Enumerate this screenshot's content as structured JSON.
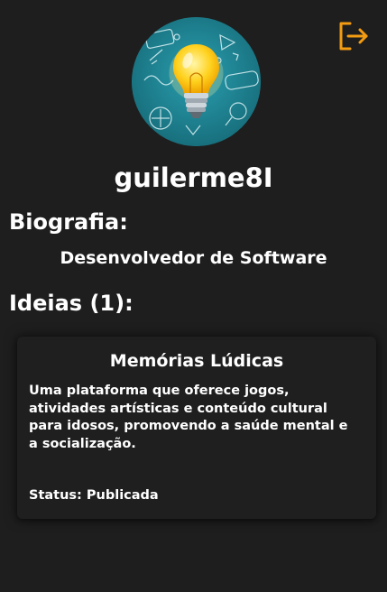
{
  "header": {
    "logout_icon": "logout-icon",
    "logout_color": "#f39c12"
  },
  "profile": {
    "avatar_icon": "lightbulb-idea-icon",
    "username": "guilerme8I"
  },
  "bio": {
    "title": "Biografia:",
    "text": "Desenvolvedor de Software"
  },
  "ideas": {
    "title": "Ideias (1):",
    "items": [
      {
        "title": "Memórias Lúdicas",
        "description": "Uma plataforma que oferece jogos, atividades artísticas e conteúdo cultural para idosos, promovendo a saúde mental e a socialização.",
        "status": "Status: Publicada"
      }
    ]
  }
}
